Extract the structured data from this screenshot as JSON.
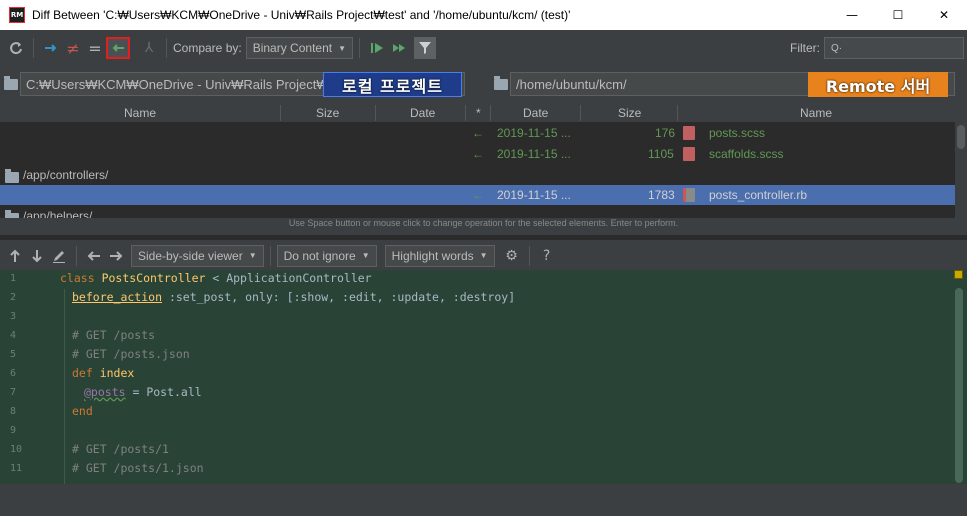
{
  "window": {
    "title": "Diff Between 'C:₩Users₩KCM₩OneDrive - Univ₩Rails Project₩test' and '/home/ubuntu/kcm/ (test)'",
    "app_icon_label": "RM",
    "minimize": "—",
    "maximize": "☐",
    "close": "✕"
  },
  "toolbar": {
    "compare_by_label": "Compare by:",
    "compare_by_value": "Binary Content",
    "filter_label": "Filter:",
    "filter_value": ""
  },
  "paths": {
    "left": "C:₩Users₩KCM₩OneDrive - Univ₩Rails Project₩test",
    "right": "/home/ubuntu/kcm/"
  },
  "annotations": {
    "left": "로컬 프로젝트",
    "right": "Remote 서버"
  },
  "table": {
    "columns": {
      "left_name": "Name",
      "left_size": "Size",
      "left_date": "Date",
      "op": "*",
      "right_date": "Date",
      "right_size": "Size",
      "right_name": "Name"
    },
    "rows": [
      {
        "op": "←",
        "date": "2019-11-15 ...",
        "size": "176",
        "name": "posts.scss"
      },
      {
        "op": "←",
        "date": "2019-11-15 ...",
        "size": "1105",
        "name": "scaffolds.scss"
      },
      {
        "folder": "/app/controllers/"
      },
      {
        "op": "←",
        "date": "2019-11-15 ...",
        "size": "1783",
        "name": "posts_controller.rb"
      },
      {
        "folder": "/app/helpers/"
      }
    ],
    "hint": "Use Space button or mouse click to change operation for the selected elements. Enter to perform."
  },
  "viewer_toolbar": {
    "viewer": "Side-by-side viewer",
    "whitespace": "Do not ignore",
    "highlight": "Highlight words"
  },
  "code_lines": [
    "1",
    "2",
    "3",
    "4",
    "5",
    "6",
    "7",
    "8",
    "9",
    "10",
    "11"
  ],
  "code": {
    "l1_kw": "class",
    "l1_cls": "PostsController",
    "l1_rest": " < ApplicationController",
    "l2_meth": "before_action",
    "l2_rest": " :set_post, only: [:show, :edit, :update, :destroy]",
    "l4": "# GET /posts",
    "l5": "# GET /posts.json",
    "l6_kw": "def",
    "l6_name": " index",
    "l7_ivar": "@posts",
    "l7_rest": " = Post.all",
    "l8": "end",
    "l10": "# GET /posts/1",
    "l11": "# GET /posts/1.json"
  }
}
